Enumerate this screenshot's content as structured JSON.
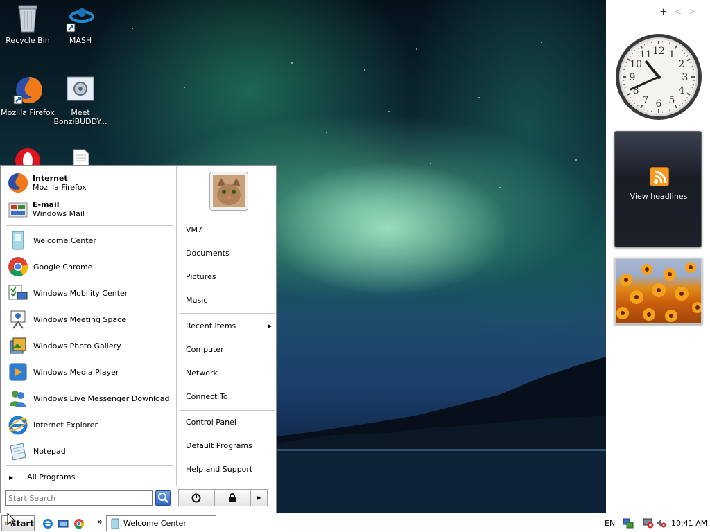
{
  "desktop": {
    "icons": [
      {
        "label": "Recycle Bin"
      },
      {
        "label": "MASH"
      },
      {
        "label": "Mozilla Firefox"
      },
      {
        "label": "Meet BonziBUDDY..."
      }
    ]
  },
  "start_menu": {
    "pinned": [
      {
        "title": "Internet",
        "subtitle": "Mozilla Firefox"
      },
      {
        "title": "E-mail",
        "subtitle": "Windows Mail"
      }
    ],
    "recent_programs": [
      "Welcome Center",
      "Google Chrome",
      "Windows Mobility Center",
      "Windows Meeting Space",
      "Windows Photo Gallery",
      "Windows Media Player",
      "Windows Live Messenger Download",
      "Internet Explorer",
      "Notepad"
    ],
    "all_programs": "All Programs",
    "search_placeholder": "Start Search",
    "right_links": {
      "user": "VM7",
      "documents": "Documents",
      "pictures": "Pictures",
      "music": "Music",
      "recent_items": "Recent Items",
      "computer": "Computer",
      "network": "Network",
      "connect_to": "Connect To",
      "control_panel": "Control Panel",
      "default_programs": "Default Programs",
      "help_support": "Help and Support"
    }
  },
  "gadgets": {
    "controls": {
      "add": "+",
      "prev": "<",
      "next": ">"
    },
    "clock": {
      "hour": 10,
      "minute": 41,
      "numbers": [
        "12",
        "1",
        "2",
        "3",
        "4",
        "5",
        "6",
        "7",
        "8",
        "9",
        "10",
        "11"
      ]
    },
    "feed": {
      "label": "View headlines"
    }
  },
  "taskbar": {
    "start_label": "Start",
    "overflow": "»",
    "tasks": [
      {
        "label": "Welcome Center"
      }
    ],
    "language": "EN",
    "time": "10:41 AM"
  },
  "colors": {
    "accent": "#2f64c6",
    "rss_orange": "#f39a1f",
    "menu_border": "#888888"
  }
}
